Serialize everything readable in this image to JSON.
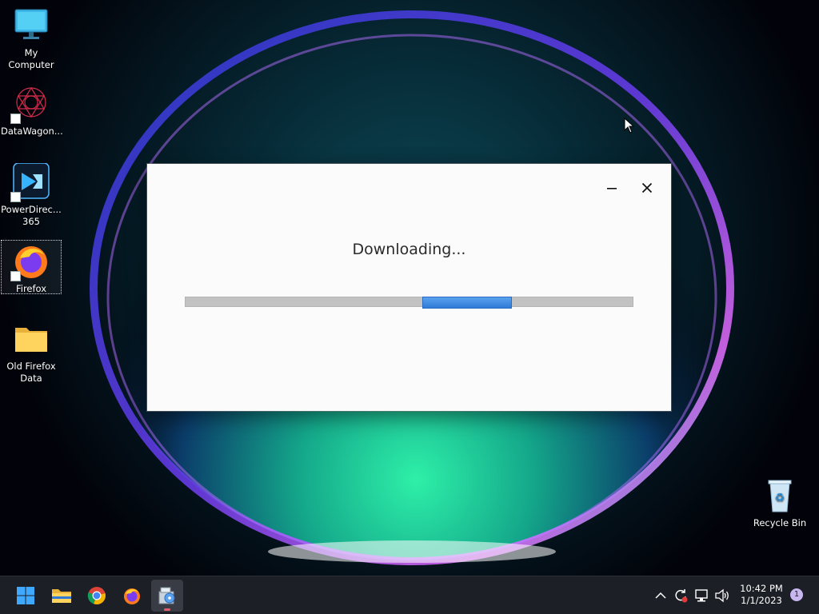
{
  "desktop": {
    "icons": [
      {
        "label": "My Computer"
      },
      {
        "label": "DataWagon..."
      },
      {
        "label": "PowerDirec... 365"
      },
      {
        "label": "Firefox"
      },
      {
        "label": "Old Firefox Data"
      },
      {
        "label": "Recycle Bin"
      }
    ]
  },
  "dialog": {
    "status_text": "Downloading...",
    "minimize_icon": "minimize-icon",
    "close_icon": "close-icon",
    "progress_style": "marquee"
  },
  "taskbar": {
    "apps": [
      "start-icon",
      "file-explorer-icon",
      "chrome-icon",
      "firefox-icon",
      "installer-icon"
    ],
    "tray": [
      "chevron-up-icon",
      "sync-icon",
      "network-icon",
      "volume-icon"
    ],
    "time": "10:42 PM",
    "date": "1/1/2023",
    "notification_count": "1"
  },
  "colors": {
    "accent": "#2f7ad8",
    "taskbar": "#1d1f26",
    "dialog_bg": "#fbfbfb"
  }
}
